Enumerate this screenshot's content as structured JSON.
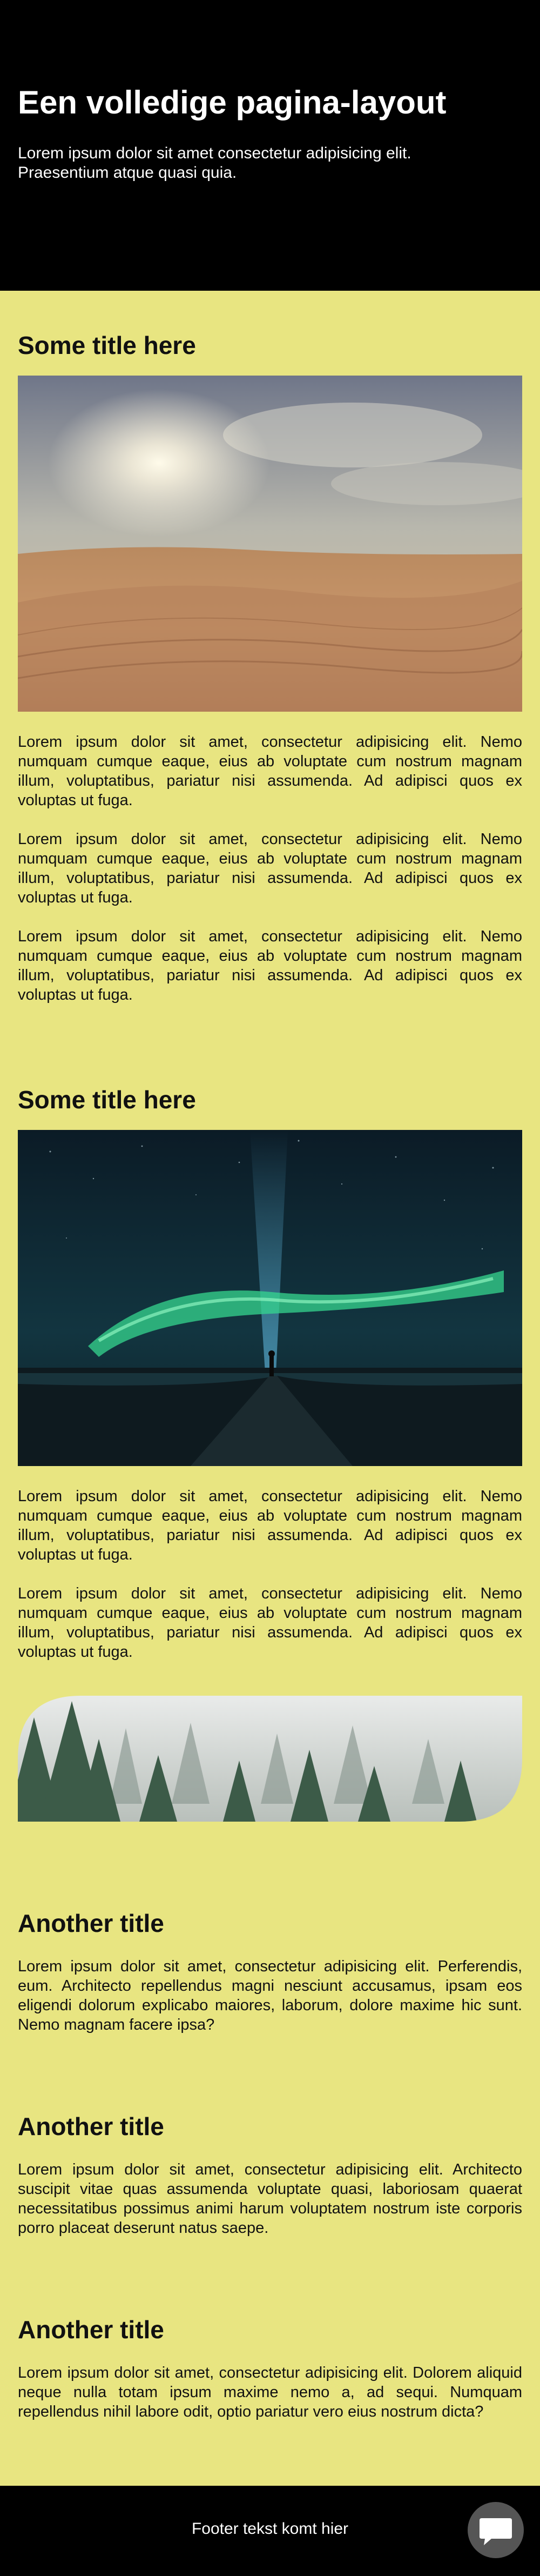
{
  "header": {
    "title": "Een volledige pagina-layout",
    "subtitle_line1": "Lorem ipsum dolor sit amet consectetur adipisicing elit.",
    "subtitle_line2": "Praesentium atque quasi quia."
  },
  "articles": [
    {
      "title": "Some title here",
      "image": "desert-dunes-image",
      "paragraphs": [
        "Lorem ipsum dolor sit amet, consectetur adipisicing elit. Nemo numquam cumque eaque, eius ab voluptate cum nostrum magnam illum, voluptatibus, pariatur nisi assumenda. Ad adipisci quos ex voluptas ut fuga.",
        "Lorem ipsum dolor sit amet, consectetur adipisicing elit. Nemo numquam cumque eaque, eius ab voluptate cum nostrum magnam illum, voluptatibus, pariatur nisi assumenda. Ad adipisci quos ex voluptas ut fuga.",
        "Lorem ipsum dolor sit amet, consectetur adipisicing elit. Nemo numquam cumque eaque, eius ab voluptate cum nostrum magnam illum, voluptatibus, pariatur nisi assumenda. Ad adipisci quos ex voluptas ut fuga."
      ]
    },
    {
      "title": "Some title here",
      "image": "aurora-night-image",
      "paragraphs": [
        "Lorem ipsum dolor sit amet, consectetur adipisicing elit. Nemo numquam cumque eaque, eius ab voluptate cum nostrum magnam illum, voluptatibus, pariatur nisi assumenda. Ad adipisci quos ex voluptas ut fuga.",
        "Lorem ipsum dolor sit amet, consectetur adipisicing elit. Nemo numquam cumque eaque, eius ab voluptate cum nostrum magnam illum, voluptatibus, pariatur nisi assumenda. Ad adipisci quos ex voluptas ut fuga."
      ]
    }
  ],
  "banner": {
    "image": "misty-forest-image"
  },
  "cards": [
    {
      "title": "Another title",
      "text": "Lorem ipsum dolor sit amet, consectetur adipisicing elit. Perferendis, eum. Architecto repellendus magni nesciunt accusamus, ipsam eos eligendi dolorum explicabo maiores, laborum, dolore maxime hic sunt. Nemo magnam facere ipsa?"
    },
    {
      "title": "Another title",
      "text": "Lorem ipsum dolor sit amet, consectetur adipisicing elit. Architecto suscipit vitae quas assumenda voluptate quasi, laboriosam quaerat necessitatibus possimus animi harum voluptatem nostrum iste corporis porro placeat deserunt natus saepe."
    },
    {
      "title": "Another title",
      "text": "Lorem ipsum dolor sit amet, consectetur adipisicing elit. Dolorem aliquid neque nulla totam ipsum maxime nemo a, ad sequi. Numquam repellendus nihil labore odit, optio pariatur vero eius nostrum dicta?"
    }
  ],
  "footer": {
    "text": "Footer tekst komt hier",
    "chat_icon": "chat-bubble-icon"
  },
  "colors": {
    "page_background": "#e8e581",
    "header_background": "#000000",
    "footer_background": "#000000",
    "chat_button": "#555555"
  }
}
